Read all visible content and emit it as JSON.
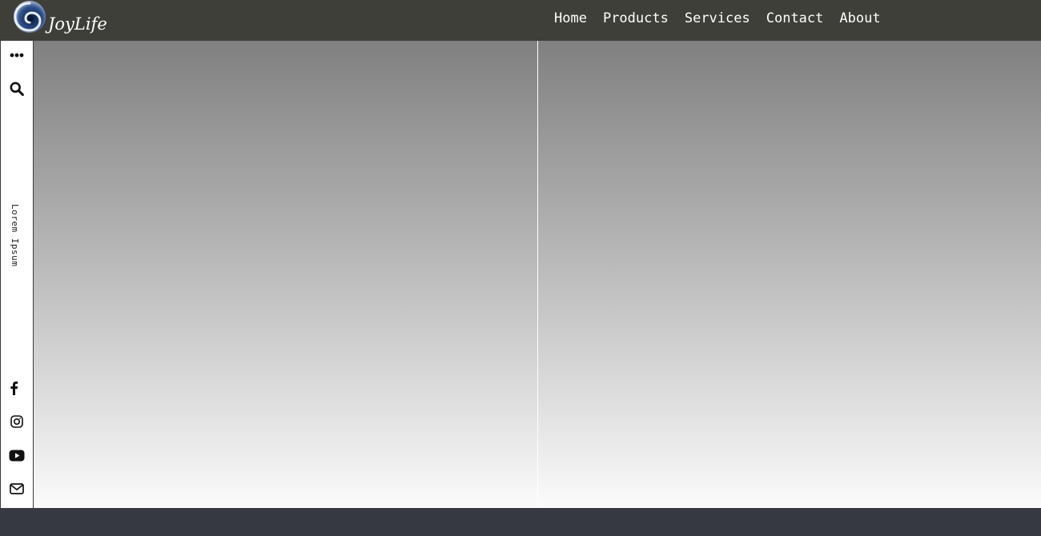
{
  "brand": {
    "name": "JoyLife",
    "logo_icon": "swirl-logo-icon"
  },
  "nav": {
    "items": [
      {
        "label": "Home"
      },
      {
        "label": "Products"
      },
      {
        "label": "Services"
      },
      {
        "label": "Contact"
      },
      {
        "label": "About"
      }
    ]
  },
  "sidebar": {
    "menu_icon": "more-horizontal-icon",
    "search_icon": "search-icon",
    "vertical_text": "Lorem Ipsum",
    "social": [
      {
        "icon": "facebook-icon"
      },
      {
        "icon": "instagram-icon"
      },
      {
        "icon": "youtube-icon"
      },
      {
        "icon": "mail-icon"
      }
    ]
  },
  "colors": {
    "topbar": "#3f3f3a",
    "footer": "#363941",
    "panel_top": "#808080",
    "panel_bottom": "#fbfbfb"
  }
}
